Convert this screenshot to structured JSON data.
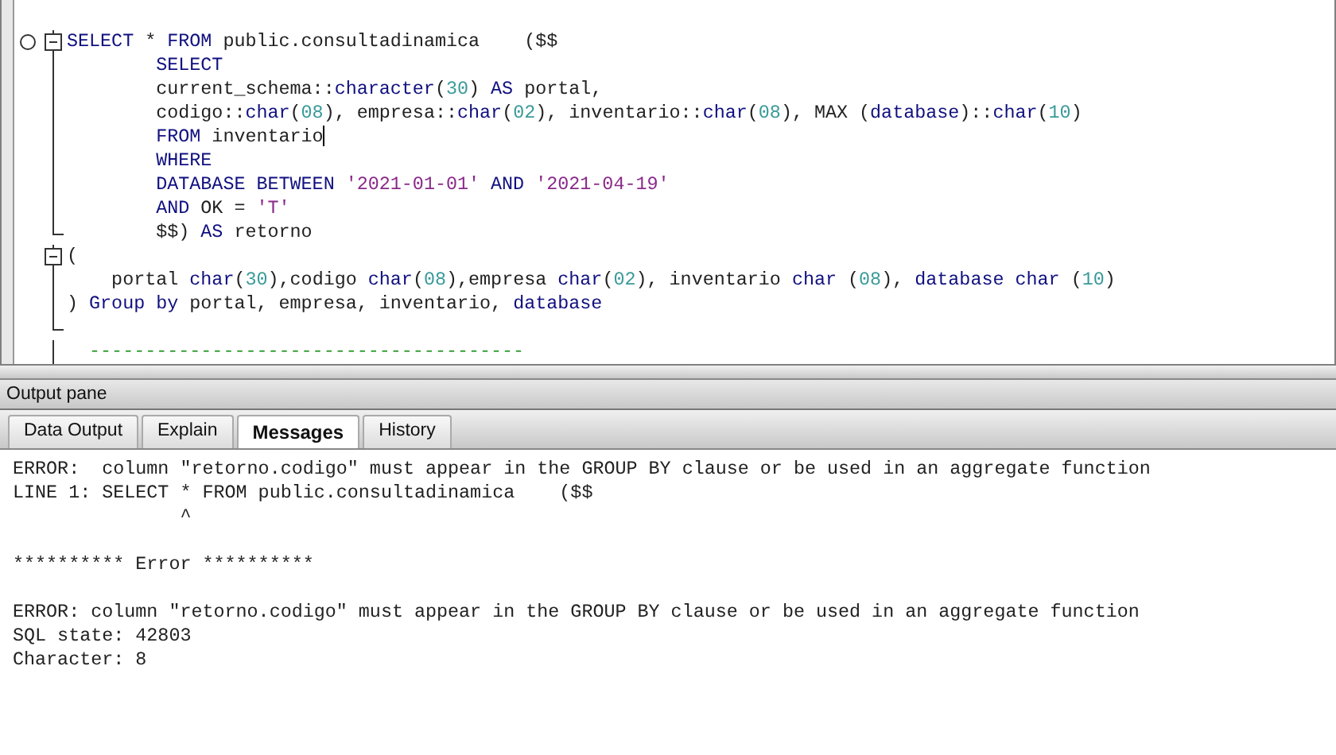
{
  "editor": {
    "lines": [
      {
        "kind": "fold-start",
        "bookmark": true,
        "cursor": false,
        "tokens": [
          {
            "kind": "keyword",
            "text": "SELECT"
          },
          {
            "kind": "text",
            "text": " * "
          },
          {
            "kind": "keyword",
            "text": "FROM"
          },
          {
            "kind": "text",
            "text": " public.consultadinamica    ($$"
          }
        ]
      },
      {
        "kind": "body",
        "bookmark": false,
        "cursor": false,
        "tokens": [
          {
            "kind": "keyword",
            "text": "        SELECT"
          }
        ]
      },
      {
        "kind": "body",
        "bookmark": false,
        "cursor": false,
        "tokens": [
          {
            "kind": "text",
            "text": "        current_schema::"
          },
          {
            "kind": "keyword",
            "text": "character"
          },
          {
            "kind": "text",
            "text": "("
          },
          {
            "kind": "number",
            "text": "30"
          },
          {
            "kind": "text",
            "text": ") "
          },
          {
            "kind": "keyword",
            "text": "AS"
          },
          {
            "kind": "text",
            "text": " portal,"
          }
        ]
      },
      {
        "kind": "body",
        "bookmark": false,
        "cursor": false,
        "tokens": [
          {
            "kind": "text",
            "text": "        codigo::"
          },
          {
            "kind": "keyword",
            "text": "char"
          },
          {
            "kind": "text",
            "text": "("
          },
          {
            "kind": "number",
            "text": "08"
          },
          {
            "kind": "text",
            "text": "), empresa::"
          },
          {
            "kind": "keyword",
            "text": "char"
          },
          {
            "kind": "text",
            "text": "("
          },
          {
            "kind": "number",
            "text": "02"
          },
          {
            "kind": "text",
            "text": "), inventario::"
          },
          {
            "kind": "keyword",
            "text": "char"
          },
          {
            "kind": "text",
            "text": "("
          },
          {
            "kind": "number",
            "text": "08"
          },
          {
            "kind": "text",
            "text": "), MAX ("
          },
          {
            "kind": "keyword",
            "text": "database"
          },
          {
            "kind": "text",
            "text": ")::"
          },
          {
            "kind": "keyword",
            "text": "char"
          },
          {
            "kind": "text",
            "text": "("
          },
          {
            "kind": "number",
            "text": "10"
          },
          {
            "kind": "text",
            "text": ")"
          }
        ]
      },
      {
        "kind": "body",
        "bookmark": false,
        "cursor": true,
        "tokens": [
          {
            "kind": "keyword",
            "text": "        FROM"
          },
          {
            "kind": "text",
            "text": " inventario"
          }
        ]
      },
      {
        "kind": "body",
        "bookmark": false,
        "cursor": false,
        "tokens": [
          {
            "kind": "keyword",
            "text": "        WHERE"
          }
        ]
      },
      {
        "kind": "body",
        "bookmark": false,
        "cursor": false,
        "tokens": [
          {
            "kind": "keyword",
            "text": "        DATABASE BETWEEN "
          },
          {
            "kind": "string",
            "text": "'2021-01-01'"
          },
          {
            "kind": "keyword",
            "text": " AND "
          },
          {
            "kind": "string",
            "text": "'2021-04-19'"
          }
        ]
      },
      {
        "kind": "body",
        "bookmark": false,
        "cursor": false,
        "tokens": [
          {
            "kind": "keyword",
            "text": "        AND"
          },
          {
            "kind": "text",
            "text": " OK = "
          },
          {
            "kind": "string",
            "text": "'T'"
          }
        ]
      },
      {
        "kind": "fold-end",
        "bookmark": false,
        "cursor": false,
        "tokens": [
          {
            "kind": "text",
            "text": "        $$) "
          },
          {
            "kind": "keyword",
            "text": "AS"
          },
          {
            "kind": "text",
            "text": " retorno"
          }
        ]
      },
      {
        "kind": "fold-start",
        "bookmark": false,
        "cursor": false,
        "tokens": [
          {
            "kind": "text",
            "text": "("
          }
        ]
      },
      {
        "kind": "body",
        "bookmark": false,
        "cursor": false,
        "tokens": [
          {
            "kind": "text",
            "text": "    portal "
          },
          {
            "kind": "keyword",
            "text": "char"
          },
          {
            "kind": "text",
            "text": "("
          },
          {
            "kind": "number",
            "text": "30"
          },
          {
            "kind": "text",
            "text": "),codigo "
          },
          {
            "kind": "keyword",
            "text": "char"
          },
          {
            "kind": "text",
            "text": "("
          },
          {
            "kind": "number",
            "text": "08"
          },
          {
            "kind": "text",
            "text": "),empresa "
          },
          {
            "kind": "keyword",
            "text": "char"
          },
          {
            "kind": "text",
            "text": "("
          },
          {
            "kind": "number",
            "text": "02"
          },
          {
            "kind": "text",
            "text": "), inventario "
          },
          {
            "kind": "keyword",
            "text": "char"
          },
          {
            "kind": "text",
            "text": " ("
          },
          {
            "kind": "number",
            "text": "08"
          },
          {
            "kind": "text",
            "text": "), "
          },
          {
            "kind": "keyword",
            "text": "database char"
          },
          {
            "kind": "text",
            "text": " ("
          },
          {
            "kind": "number",
            "text": "10"
          },
          {
            "kind": "text",
            "text": ")"
          }
        ]
      },
      {
        "kind": "body",
        "bookmark": false,
        "cursor": false,
        "tokens": [
          {
            "kind": "text",
            "text": ") "
          },
          {
            "kind": "keyword",
            "text": "Group by"
          },
          {
            "kind": "text",
            "text": " portal, empresa, inventario, "
          },
          {
            "kind": "keyword",
            "text": "database"
          }
        ]
      },
      {
        "kind": "fold-end",
        "bookmark": false,
        "cursor": false
      },
      {
        "kind": "body",
        "bookmark": false,
        "cursor": false,
        "tokens": [
          {
            "kind": "comment",
            "text": "  ---------------------------------------"
          }
        ]
      }
    ]
  },
  "output_pane": {
    "title": "Output pane",
    "tabs": [
      {
        "label": "Data Output",
        "selected": false
      },
      {
        "label": "Explain",
        "selected": false
      },
      {
        "label": "Messages",
        "selected": true
      },
      {
        "label": "History",
        "selected": false
      }
    ],
    "message_blocks": [
      [
        "ERROR:  column \"retorno.codigo\" must appear in the GROUP BY clause or be used in an aggregate function",
        "LINE 1: SELECT * FROM public.consultadinamica    ($$",
        "               ^"
      ],
      [
        "********** Error **********"
      ],
      [
        "ERROR: column \"retorno.codigo\" must appear in the GROUP BY clause or be used in an aggregate function",
        "SQL state: 42803",
        "Character: 8"
      ]
    ]
  }
}
